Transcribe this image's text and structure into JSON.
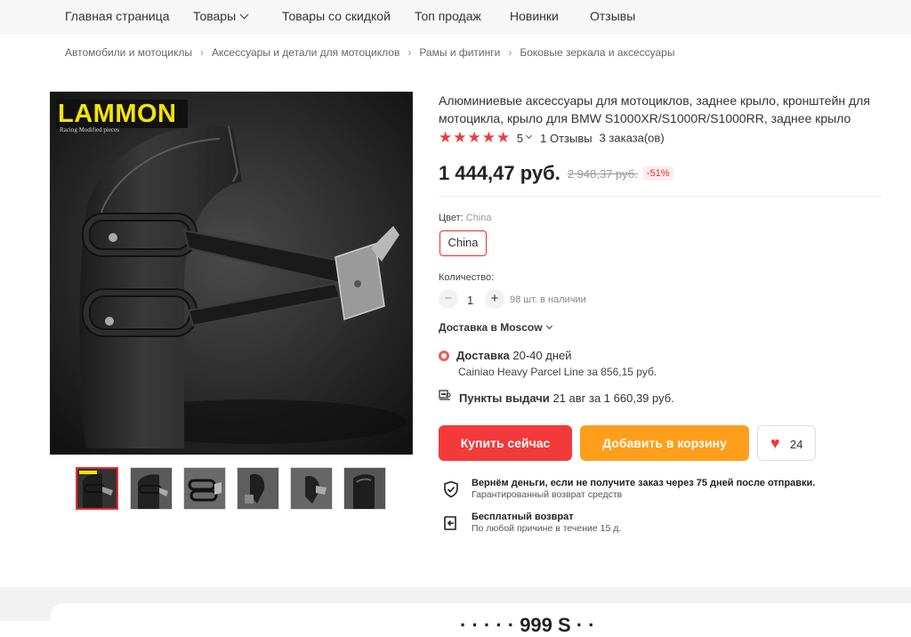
{
  "nav": {
    "items": [
      {
        "label": "Главная страница"
      },
      {
        "label": "Товары"
      },
      {
        "label": "Товары со скидкой"
      },
      {
        "label": "Топ продаж"
      },
      {
        "label": "Новинки"
      },
      {
        "label": "Отзывы"
      }
    ]
  },
  "breadcrumbs": [
    "Автомобили и мотоциклы",
    "Аксессуары и детали для мотоциклов",
    "Рамы и фитинги",
    "Боковые зеркала и аксессуары"
  ],
  "product": {
    "brand_logo_text": "LAMMON",
    "brand_logo_sub": "Racing Modified pieces",
    "title": "Алюминиевые аксессуары для мотоциклов, заднее крыло, кронштейн для мотоцикла, крыло для BMW S1000XR/S1000R/S1000RR, заднее крыло",
    "rating_value": "5",
    "reviews": "1 Отзывы",
    "orders": "3 заказа(ов)",
    "price": "1 444,47 руб.",
    "old_price": "2 948,37 руб.",
    "discount": "-51%",
    "color_label": "Цвет:",
    "color_value": "China",
    "color_chip": "China",
    "qty_label": "Количество:",
    "qty_minus": "−",
    "qty_value": "1",
    "qty_plus": "+",
    "stock": "98 шт. в наличии"
  },
  "delivery": {
    "to_label": "Доставка в Moscow",
    "option_title": "Доставка",
    "option_days": "20-40 дней",
    "option_carrier": "Cainiao Heavy Parcel Line за 856,15 руб.",
    "pickup_title": "Пункты выдачи",
    "pickup_info": "21 авг за 1 660,39 руб."
  },
  "actions": {
    "buy_now": "Купить сейчас",
    "add_to_cart": "Добавить в корзину",
    "favorites_count": "24"
  },
  "guarantees": [
    {
      "title": "Вернём деньги, если не получите заказ через 75 дней после отправки.",
      "subtitle": "Гарантированный возврат средств",
      "icon": "shield-check-icon"
    },
    {
      "title": "Бесплатный возврат",
      "subtitle": "По любой причине в течение 15 д.",
      "icon": "return-box-icon"
    }
  ],
  "colors": {
    "accent_red": "#f23a3a",
    "accent_orange": "#ff9e1b",
    "logo_yellow": "#f5e400"
  },
  "bottom": {
    "partial_text": "· · · · ·  999 S · ·"
  }
}
